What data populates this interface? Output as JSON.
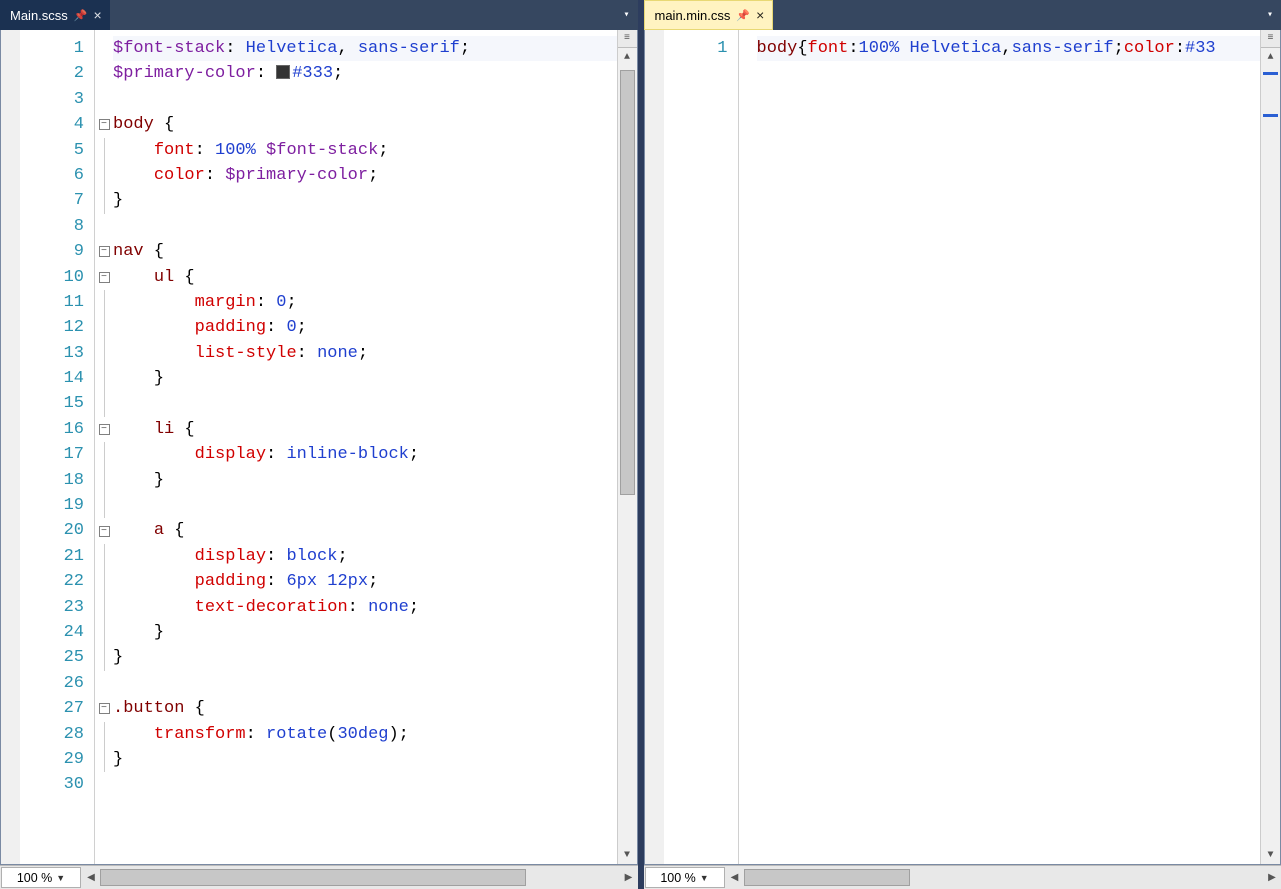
{
  "left": {
    "tab": {
      "filename": "Main.scss",
      "pinned": true,
      "active_style": "dark"
    },
    "zoom": "100 %",
    "lines": [
      {
        "n": 1,
        "fold": "",
        "hl": true,
        "tokens": [
          [
            "var",
            "$font-stack"
          ],
          [
            "punc",
            ": "
          ],
          [
            "val",
            "Helvetica"
          ],
          [
            "punc",
            ", "
          ],
          [
            "val",
            "sans-serif"
          ],
          [
            "punc",
            ";"
          ]
        ]
      },
      {
        "n": 2,
        "fold": "",
        "tokens": [
          [
            "var",
            "$primary-color"
          ],
          [
            "punc",
            ": "
          ],
          [
            "swatch",
            "#333"
          ],
          [
            "hex",
            "#333"
          ],
          [
            "punc",
            ";"
          ]
        ]
      },
      {
        "n": 3,
        "fold": "",
        "tokens": []
      },
      {
        "n": 4,
        "fold": "box",
        "tokens": [
          [
            "sel",
            "body"
          ],
          [
            "punc",
            " {"
          ]
        ]
      },
      {
        "n": 5,
        "fold": "line",
        "tokens": [
          [
            "plain",
            "    "
          ],
          [
            "prop",
            "font"
          ],
          [
            "punc",
            ": "
          ],
          [
            "val",
            "100%"
          ],
          [
            "punc",
            " "
          ],
          [
            "var",
            "$font-stack"
          ],
          [
            "punc",
            ";"
          ]
        ]
      },
      {
        "n": 6,
        "fold": "line",
        "tokens": [
          [
            "plain",
            "    "
          ],
          [
            "prop",
            "color"
          ],
          [
            "punc",
            ": "
          ],
          [
            "var",
            "$primary-color"
          ],
          [
            "punc",
            ";"
          ]
        ]
      },
      {
        "n": 7,
        "fold": "line",
        "tokens": [
          [
            "punc",
            "}"
          ]
        ]
      },
      {
        "n": 8,
        "fold": "",
        "tokens": []
      },
      {
        "n": 9,
        "fold": "box",
        "tokens": [
          [
            "sel",
            "nav"
          ],
          [
            "punc",
            " {"
          ]
        ]
      },
      {
        "n": 10,
        "fold": "box",
        "tokens": [
          [
            "plain",
            "    "
          ],
          [
            "sel",
            "ul"
          ],
          [
            "punc",
            " {"
          ]
        ]
      },
      {
        "n": 11,
        "fold": "line",
        "tokens": [
          [
            "plain",
            "        "
          ],
          [
            "prop",
            "margin"
          ],
          [
            "punc",
            ": "
          ],
          [
            "num",
            "0"
          ],
          [
            "punc",
            ";"
          ]
        ]
      },
      {
        "n": 12,
        "fold": "line",
        "tokens": [
          [
            "plain",
            "        "
          ],
          [
            "prop",
            "padding"
          ],
          [
            "punc",
            ": "
          ],
          [
            "num",
            "0"
          ],
          [
            "punc",
            ";"
          ]
        ]
      },
      {
        "n": 13,
        "fold": "line",
        "tokens": [
          [
            "plain",
            "        "
          ],
          [
            "prop",
            "list-style"
          ],
          [
            "punc",
            ": "
          ],
          [
            "val",
            "none"
          ],
          [
            "punc",
            ";"
          ]
        ]
      },
      {
        "n": 14,
        "fold": "line",
        "tokens": [
          [
            "plain",
            "    "
          ],
          [
            "punc",
            "}"
          ]
        ]
      },
      {
        "n": 15,
        "fold": "line",
        "tokens": []
      },
      {
        "n": 16,
        "fold": "box",
        "tokens": [
          [
            "plain",
            "    "
          ],
          [
            "sel",
            "li"
          ],
          [
            "punc",
            " {"
          ]
        ]
      },
      {
        "n": 17,
        "fold": "line",
        "tokens": [
          [
            "plain",
            "        "
          ],
          [
            "prop",
            "display"
          ],
          [
            "punc",
            ": "
          ],
          [
            "val",
            "inline-block"
          ],
          [
            "punc",
            ";"
          ]
        ]
      },
      {
        "n": 18,
        "fold": "line",
        "tokens": [
          [
            "plain",
            "    "
          ],
          [
            "punc",
            "}"
          ]
        ]
      },
      {
        "n": 19,
        "fold": "line",
        "tokens": []
      },
      {
        "n": 20,
        "fold": "box",
        "tokens": [
          [
            "plain",
            "    "
          ],
          [
            "sel",
            "a"
          ],
          [
            "punc",
            " {"
          ]
        ]
      },
      {
        "n": 21,
        "fold": "line",
        "tokens": [
          [
            "plain",
            "        "
          ],
          [
            "prop",
            "display"
          ],
          [
            "punc",
            ": "
          ],
          [
            "val",
            "block"
          ],
          [
            "punc",
            ";"
          ]
        ]
      },
      {
        "n": 22,
        "fold": "line",
        "tokens": [
          [
            "plain",
            "        "
          ],
          [
            "prop",
            "padding"
          ],
          [
            "punc",
            ": "
          ],
          [
            "num",
            "6px"
          ],
          [
            "punc",
            " "
          ],
          [
            "num",
            "12px"
          ],
          [
            "punc",
            ";"
          ]
        ]
      },
      {
        "n": 23,
        "fold": "line",
        "tokens": [
          [
            "plain",
            "        "
          ],
          [
            "prop",
            "text-decoration"
          ],
          [
            "punc",
            ": "
          ],
          [
            "val",
            "none"
          ],
          [
            "punc",
            ";"
          ]
        ]
      },
      {
        "n": 24,
        "fold": "line",
        "tokens": [
          [
            "plain",
            "    "
          ],
          [
            "punc",
            "}"
          ]
        ]
      },
      {
        "n": 25,
        "fold": "line",
        "tokens": [
          [
            "punc",
            "}"
          ]
        ]
      },
      {
        "n": 26,
        "fold": "",
        "tokens": []
      },
      {
        "n": 27,
        "fold": "box",
        "tokens": [
          [
            "class",
            ".button"
          ],
          [
            "punc",
            " {"
          ]
        ]
      },
      {
        "n": 28,
        "fold": "line",
        "tokens": [
          [
            "plain",
            "    "
          ],
          [
            "prop",
            "transform"
          ],
          [
            "punc",
            ": "
          ],
          [
            "kw",
            "rotate"
          ],
          [
            "punc",
            "("
          ],
          [
            "num",
            "30deg"
          ],
          [
            "punc",
            ");"
          ]
        ]
      },
      {
        "n": 29,
        "fold": "line",
        "tokens": [
          [
            "punc",
            "}"
          ]
        ]
      },
      {
        "n": 30,
        "fold": "",
        "tokens": []
      }
    ]
  },
  "right": {
    "tab": {
      "filename": "main.min.css",
      "pinned": true,
      "active_style": "yellow"
    },
    "zoom": "100 %",
    "lines": [
      {
        "n": 1,
        "fold": "",
        "hl": true,
        "tokens": [
          [
            "sel",
            "body"
          ],
          [
            "punc",
            "{"
          ],
          [
            "prop",
            "font"
          ],
          [
            "punc",
            ":"
          ],
          [
            "val",
            "100%"
          ],
          [
            "punc",
            " "
          ],
          [
            "val",
            "Helvetica"
          ],
          [
            "punc",
            ","
          ],
          [
            "val",
            "sans-serif"
          ],
          [
            "punc",
            ";"
          ],
          [
            "prop",
            "color"
          ],
          [
            "punc",
            ":"
          ],
          [
            "hex",
            "#33"
          ]
        ]
      }
    ]
  }
}
